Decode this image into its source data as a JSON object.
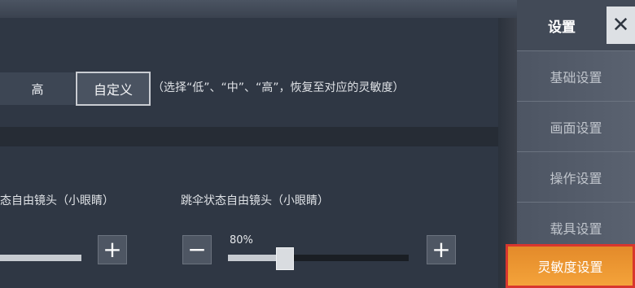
{
  "sensitivity": {
    "options": [
      {
        "label": "高"
      },
      {
        "label": "自定义",
        "selected": true
      }
    ],
    "hint": "（选择“低”、“中”、“高”，恢复至对应的灵敏度）"
  },
  "camera": {
    "left_label": "态自由镜头（小眼睛）",
    "right_label": "跳伞状态自由镜头（小眼睛）",
    "right_value_text": "80%",
    "right_value_fraction": 0.8
  },
  "sidebar": {
    "title": "设置",
    "close_glyph": "✕",
    "items": [
      {
        "label": "基础设置"
      },
      {
        "label": "画面设置"
      },
      {
        "label": "操作设置"
      },
      {
        "label": "载具设置"
      },
      {
        "label": "灵敏度设置",
        "active": true
      }
    ]
  },
  "icons": {
    "plus": "+",
    "minus": "−"
  }
}
